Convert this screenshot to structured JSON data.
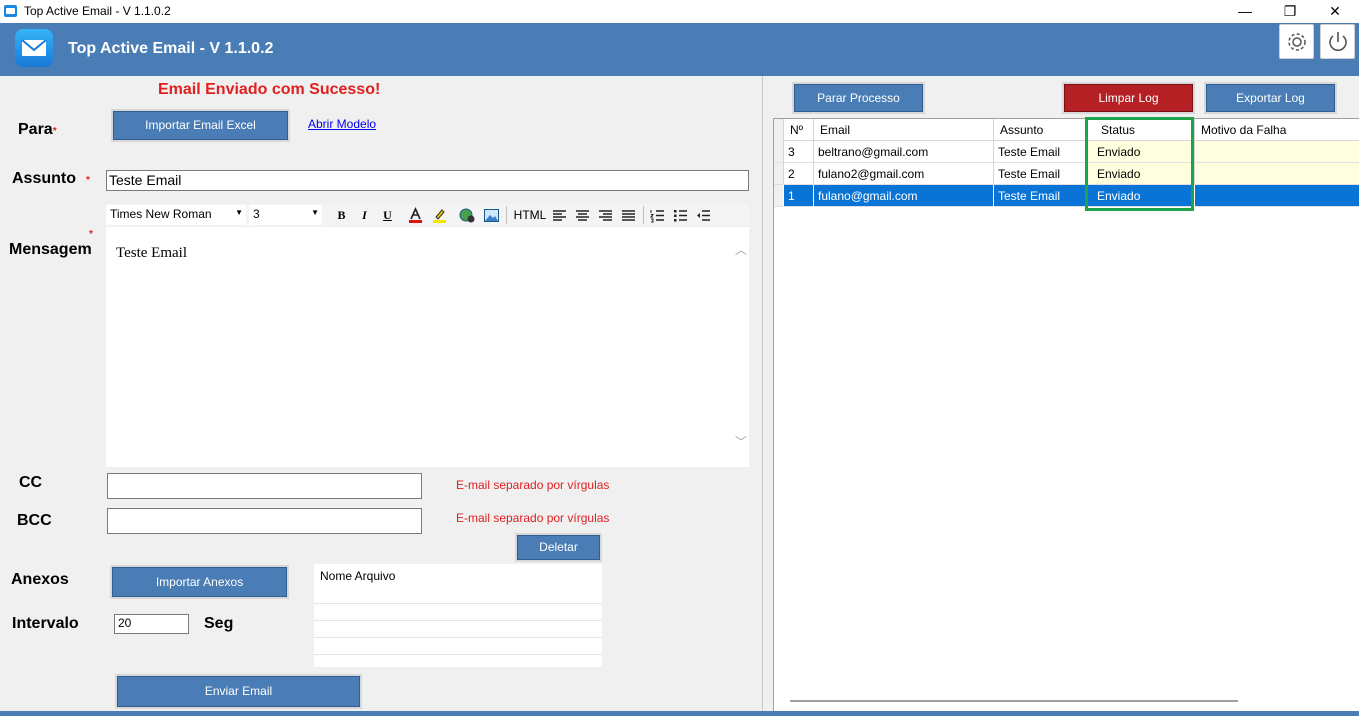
{
  "window": {
    "title": "Top Active Email - V 1.1.0.2",
    "minimize": "—",
    "maximize": "❐",
    "close": "✕"
  },
  "header": {
    "title": "Top Active Email - V 1.1.0.2",
    "icons": [
      "mail-icon",
      "gear-icon",
      "power-icon"
    ]
  },
  "form": {
    "success_message": "Email Enviado com Sucesso!",
    "to_label": "Para",
    "import_excel_button": "Importar Email Excel",
    "open_template_link": "Abrir Modelo",
    "subject_label": "Assunto",
    "subject_value": "Teste Email",
    "message_label": "Mensagem",
    "message_body": "Teste Email",
    "cc_label": "CC",
    "cc_hint": "E-mail separado por vírgulas",
    "bcc_label": "BCC",
    "bcc_hint": "E-mail separado por vírgulas",
    "delete_button": "Deletar",
    "attachments_label": "Anexos",
    "import_attachments_button": "Importar Anexos",
    "attachments_column": "Nome Arquivo",
    "interval_label": "Intervalo",
    "interval_value": "20",
    "interval_unit": "Seg",
    "send_button": "Enviar Email"
  },
  "editor_toolbar": {
    "font_family": "Times New Roman",
    "font_size": "3",
    "bold": "B",
    "italic": "I",
    "underline": "U",
    "html": "HTML"
  },
  "log": {
    "stop_button": "Parar Processo",
    "clear_button": "Limpar Log",
    "export_button": "Exportar Log",
    "columns": [
      "Nº",
      "Email",
      "Assunto",
      "Status",
      "Motivo da Falha"
    ],
    "rows": [
      {
        "n": "3",
        "email": "beltrano@gmail.com",
        "subject": "Teste Email",
        "status": "Enviado",
        "reason": ""
      },
      {
        "n": "2",
        "email": "fulano2@gmail.com",
        "subject": "Teste Email",
        "status": "Enviado",
        "reason": ""
      },
      {
        "n": "1",
        "email": "fulano@gmail.com",
        "subject": "Teste Email",
        "status": "Enviado",
        "reason": ""
      }
    ]
  },
  "colors": {
    "header_bg": "#4a7db5",
    "danger_button": "#b52025",
    "success_text": "#e02020",
    "highlight_box": "#1fa34a",
    "selected_row": "#0a74d6"
  }
}
